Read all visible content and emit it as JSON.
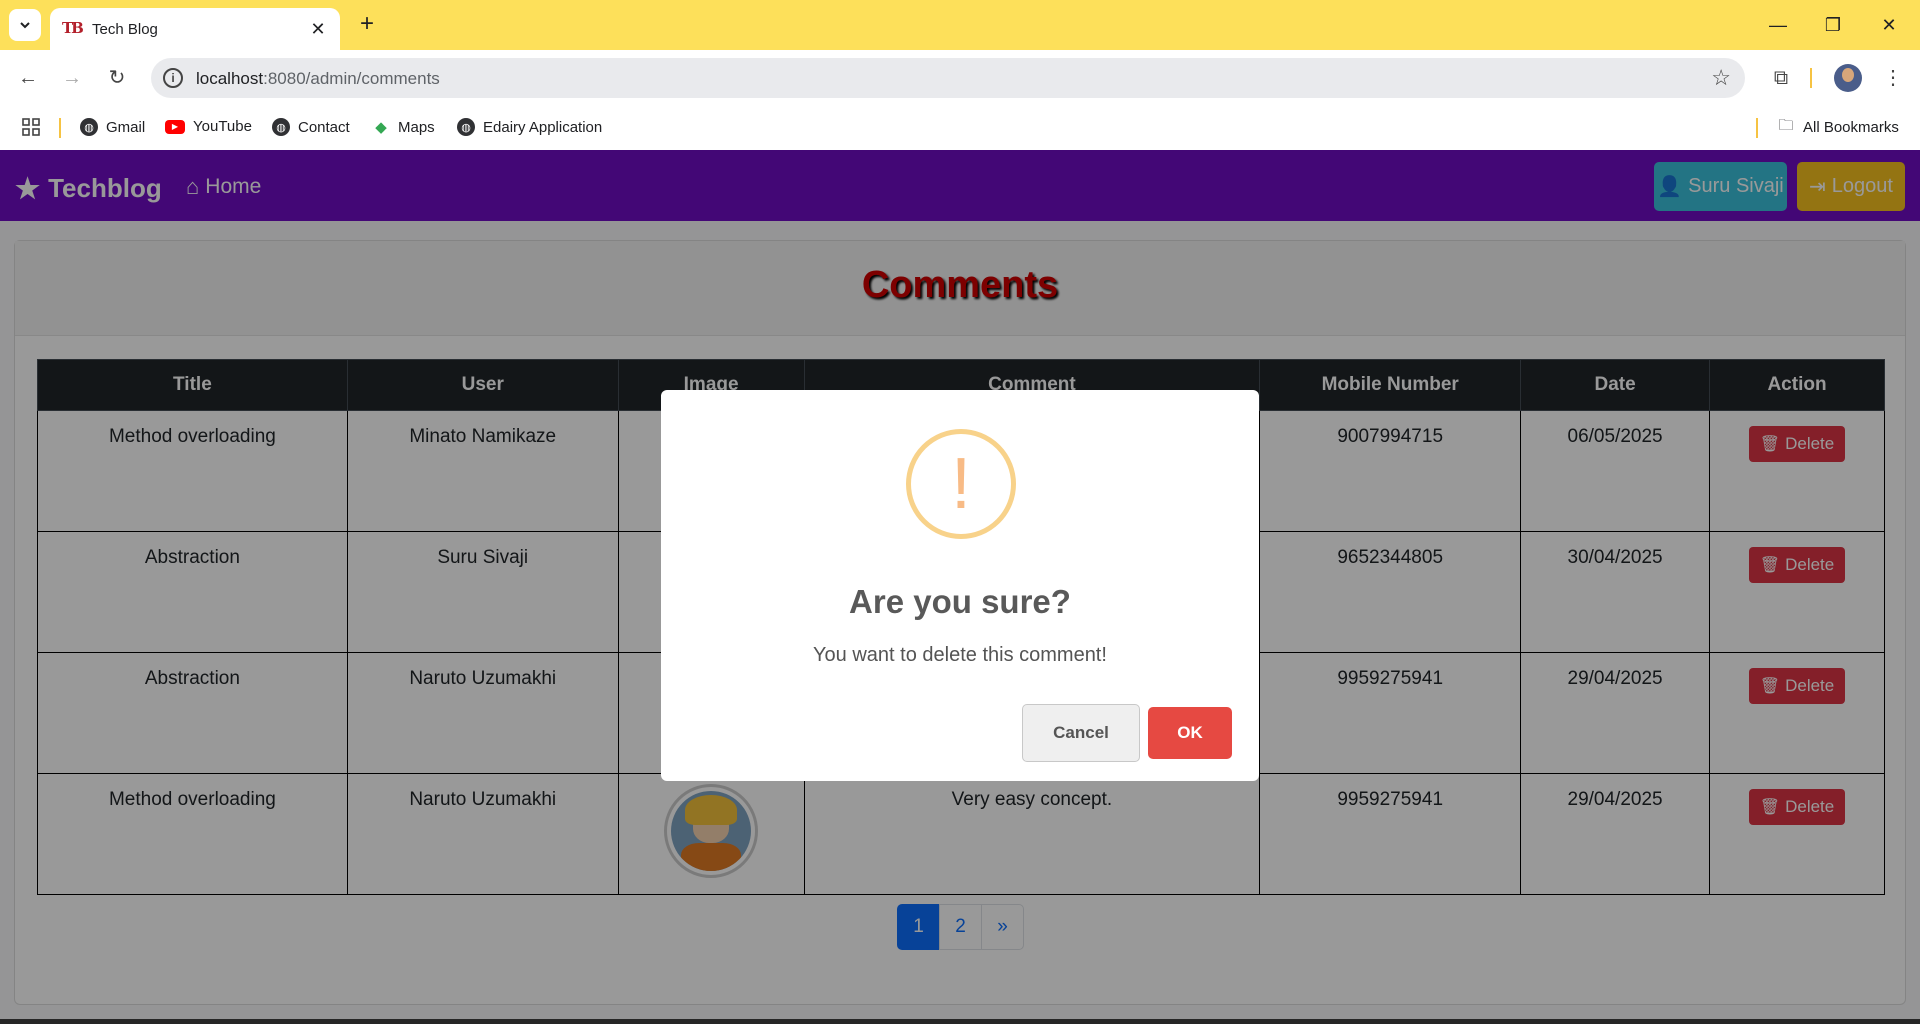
{
  "browser": {
    "tab_title": "Tech Blog",
    "tab_favicon_text": "TB",
    "url_host": "localhost",
    "url_path": ":8080/admin/comments",
    "bookmarks": [
      {
        "label": "Gmail",
        "icon": "globe-icon"
      },
      {
        "label": "YouTube",
        "icon": "youtube-icon"
      },
      {
        "label": "Contact",
        "icon": "globe-icon"
      },
      {
        "label": "Maps",
        "icon": "maps-icon"
      },
      {
        "label": "Edairy Application",
        "icon": "globe-icon"
      }
    ],
    "all_bookmarks": "All Bookmarks"
  },
  "nav": {
    "brand": "Techblog",
    "home": "Home",
    "user": "Suru Sivaji",
    "logout": "Logout"
  },
  "page": {
    "title": "Comments",
    "columns": [
      "Title",
      "User",
      "Image",
      "Comment",
      "Mobile Number",
      "Date",
      "Action"
    ],
    "rows": [
      {
        "title": "Method overloading",
        "user": "Minato Namikaze",
        "comment": "",
        "mobile": "9007994715",
        "date": "06/05/2025",
        "action": "Delete"
      },
      {
        "title": "Abstraction",
        "user": "Suru Sivaji",
        "comment": "",
        "mobile": "9652344805",
        "date": "30/04/2025",
        "action": "Delete"
      },
      {
        "title": "Abstraction",
        "user": "Naruto Uzumakhi",
        "comment": "",
        "mobile": "9959275941",
        "date": "29/04/2025",
        "action": "Delete"
      },
      {
        "title": "Method overloading",
        "user": "Naruto Uzumakhi",
        "comment": "Very easy concept.",
        "mobile": "9959275941",
        "date": "29/04/2025",
        "action": "Delete"
      }
    ],
    "pagination": [
      "1",
      "2",
      "»"
    ]
  },
  "modal": {
    "icon": "!",
    "title": "Are you sure?",
    "text": "You want to delete this comment!",
    "cancel": "Cancel",
    "ok": "OK"
  },
  "colors": {
    "navbar": "#700dc5",
    "title": "#d10000",
    "delete": "#dc3545",
    "ok": "#e64942",
    "warning": "#f8bb86"
  }
}
